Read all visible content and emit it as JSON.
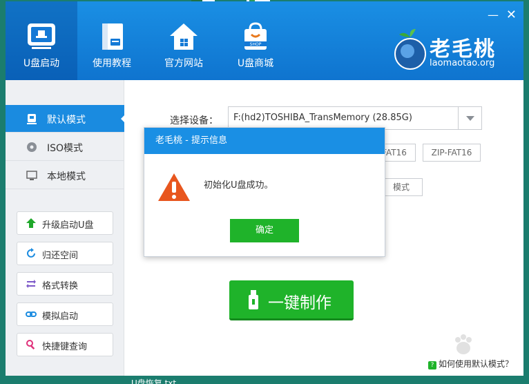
{
  "app": {
    "brand": "老毛桃",
    "site": "laomaotao.org",
    "min_glyph": "—",
    "close_glyph": "✕"
  },
  "nav": [
    {
      "label": "U盘启动",
      "icon": "usb-drive-icon",
      "active": true
    },
    {
      "label": "使用教程",
      "icon": "book-icon"
    },
    {
      "label": "官方网站",
      "icon": "home-icon"
    },
    {
      "label": "U盘商城",
      "icon": "shop-bag-icon"
    }
  ],
  "sidebar": {
    "modes": [
      {
        "label": "默认模式",
        "icon": "usb-mode-icon",
        "active": true
      },
      {
        "label": "ISO模式",
        "icon": "disc-icon"
      },
      {
        "label": "本地模式",
        "icon": "monitor-icon"
      }
    ],
    "tools": [
      {
        "label": "升级启动U盘",
        "icon": "arrow-up-icon"
      },
      {
        "label": "归还空间",
        "icon": "refresh-icon"
      },
      {
        "label": "格式转换",
        "icon": "swap-icon"
      },
      {
        "label": "模拟启动",
        "icon": "link-icon"
      },
      {
        "label": "快捷键查询",
        "icon": "search-icon"
      }
    ]
  },
  "main": {
    "device_label": "选择设备：",
    "device_value": "F:(hd2)TOSHIBA_TransMemory (28.85G)",
    "format_options": [
      "FAT16",
      "ZIP-FAT16"
    ],
    "mode_partial": "模式",
    "make_button": "一键制作"
  },
  "dialog": {
    "title": "老毛桃 - 提示信息",
    "message": "初始化U盘成功。",
    "ok": "确定"
  },
  "help_link": "如何使用默认模式？",
  "desktop_text": "U盘恢复.txt",
  "colors": {
    "header": "#1a8fe4",
    "accent_green": "#1fb32a",
    "sidebar_active": "#1a8be0"
  }
}
